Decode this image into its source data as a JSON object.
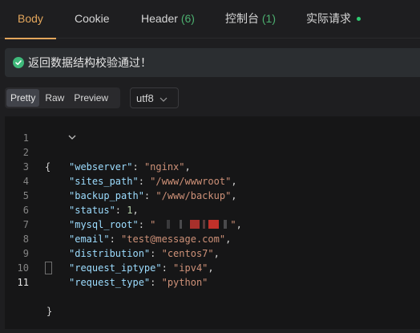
{
  "tabs": {
    "body": "Body",
    "cookie": "Cookie",
    "header_label": "Header",
    "header_count": "(6)",
    "console_label": "控制台",
    "console_count": "(1)",
    "actual_request": "实际请求"
  },
  "banner": {
    "message": "返回数据结构校验通过！"
  },
  "view_modes": {
    "pretty": "Pretty",
    "raw": "Raw",
    "preview": "Preview"
  },
  "encoding": {
    "value": "utf8"
  },
  "editor": {
    "line_numbers": [
      "1",
      "2",
      "3",
      "4",
      "5",
      "6",
      "7",
      "8",
      "9",
      "10",
      "11"
    ],
    "lines": {
      "open_brace": "{",
      "close_brace": "}",
      "webserver_key": "\"webserver\"",
      "webserver_val": "\"nginx\"",
      "sites_path_key": "\"sites_path\"",
      "sites_path_val": "\"/www/wwwroot\"",
      "backup_path_key": "\"backup_path\"",
      "backup_path_val": "\"/www/backup\"",
      "status_key": "\"status\"",
      "status_val": "1",
      "mysql_root_key": "\"mysql_root\"",
      "mysql_root_open_quote": "\"",
      "mysql_root_close_quote": "\"",
      "email_key": "\"email\"",
      "email_val": "\"test@message.com\"",
      "distribution_key": "\"distribution\"",
      "distribution_val": "\"centos7\"",
      "request_iptype_key": "\"request_iptype\"",
      "request_iptype_val": "\"ipv4\"",
      "request_type_key": "\"request_type\"",
      "request_type_val": "\"python\""
    }
  },
  "colors": {
    "accent": "#e3a65c",
    "success": "#3fb97a",
    "json_key": "#9cdcfe",
    "json_string": "#ce9178",
    "json_number": "#b5cea8"
  }
}
